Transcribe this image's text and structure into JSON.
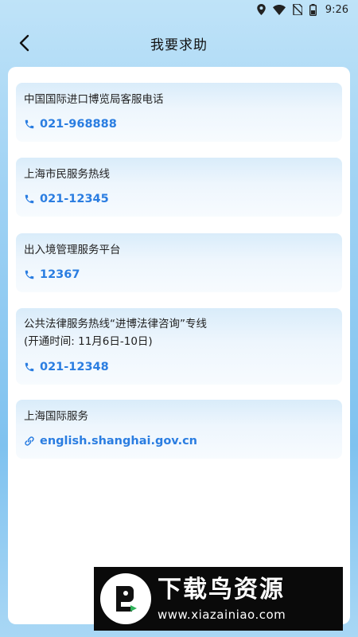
{
  "status": {
    "time": "9:26",
    "icons": [
      "location-icon",
      "wifi-icon",
      "no-sim-icon",
      "battery-icon"
    ]
  },
  "header": {
    "title": "我要求助",
    "back_icon": "chevron-left-icon"
  },
  "cards": [
    {
      "title": "中国国际进口博览局客服电话",
      "value": "021-968888",
      "icon": "phone-icon"
    },
    {
      "title": "上海市民服务热线",
      "value": "021-12345",
      "icon": "phone-icon"
    },
    {
      "title": "出入境管理服务平台",
      "value": "12367",
      "icon": "phone-icon"
    },
    {
      "title": "公共法律服务热线“进博法律咨询”专线",
      "subtitle": "(开通时间: 11月6日-10日)",
      "value": "021-12348",
      "icon": "phone-icon"
    },
    {
      "title": "上海国际服务",
      "value": "english.shanghai.gov.cn",
      "icon": "link-icon"
    }
  ],
  "watermark": {
    "title": "下载鸟资源",
    "url": "www.xiazainiao.com"
  },
  "colors": {
    "accent": "#2a7de1",
    "card_top": "#d9ecfa",
    "background_top": "#bfe3f8"
  }
}
